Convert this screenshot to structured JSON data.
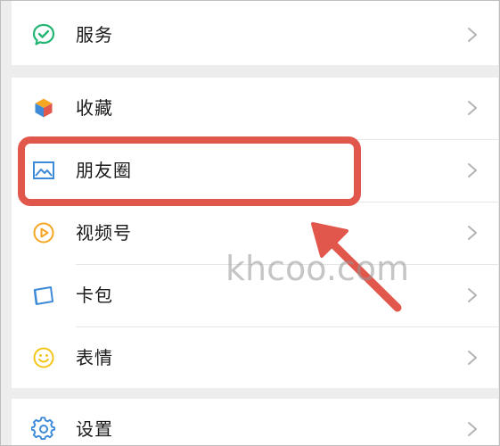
{
  "menu": {
    "services": {
      "label": "服务",
      "icon": "services-check-icon",
      "color": "#22b573"
    },
    "favorites": {
      "label": "收藏",
      "icon": "favorites-cube-icon"
    },
    "moments": {
      "label": "朋友圈",
      "icon": "moments-image-icon",
      "color": "#3d8ad8"
    },
    "channels": {
      "label": "视频号",
      "icon": "channels-play-icon",
      "color": "#f5a623"
    },
    "cards": {
      "label": "卡包",
      "icon": "card-wallet-icon",
      "color": "#3d8ad8"
    },
    "stickers": {
      "label": "表情",
      "icon": "sticker-smile-icon",
      "color": "#f5c518"
    },
    "settings": {
      "label": "设置",
      "icon": "settings-gear-icon",
      "color": "#3d8ad8"
    }
  },
  "annotation": {
    "highlight_color": "#e2574c"
  },
  "watermark": "khcoo.com"
}
